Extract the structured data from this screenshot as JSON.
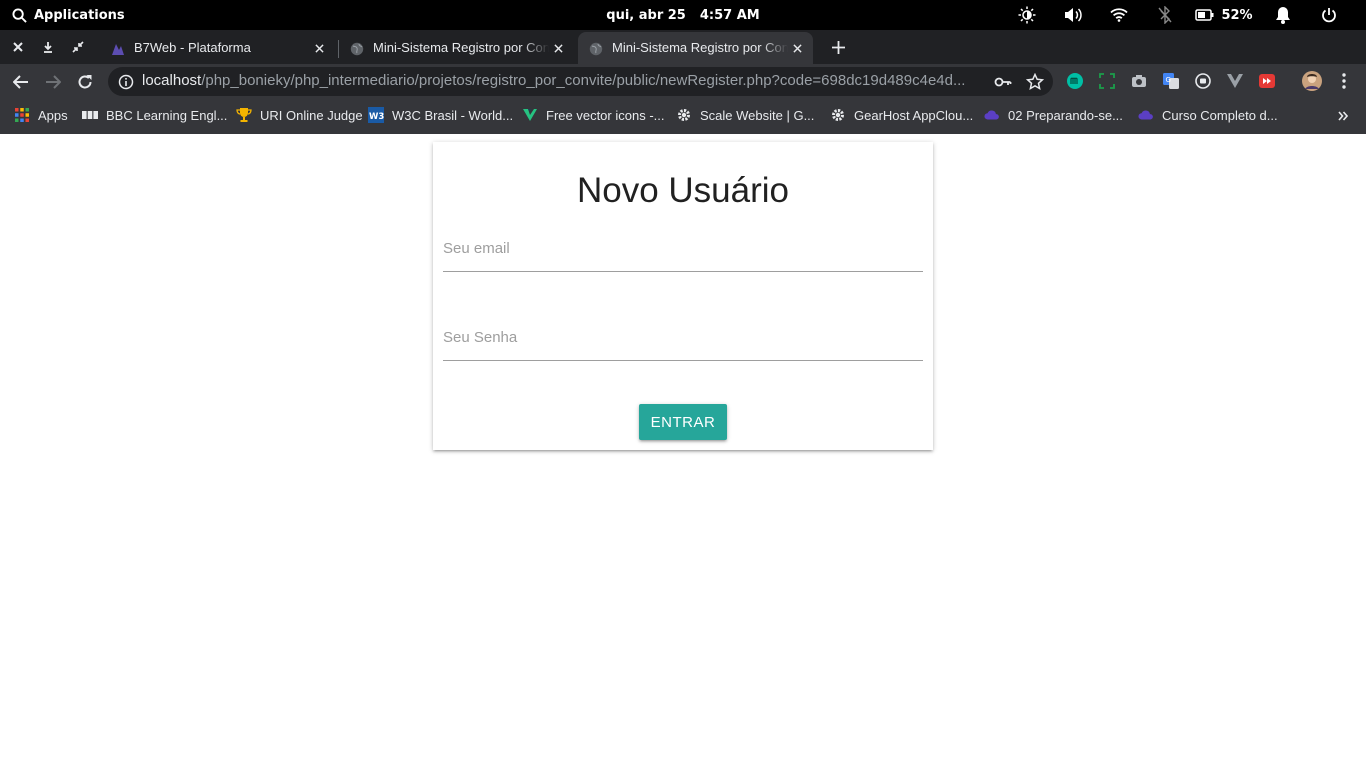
{
  "os": {
    "applications_label": "Applications",
    "date": "qui, abr 25",
    "time": "4:57 AM",
    "battery_percent": "52%"
  },
  "tabs": [
    {
      "title": "B7Web - Plataforma",
      "active": false
    },
    {
      "title": "Mini-Sistema Registro por Convite",
      "active": false
    },
    {
      "title": "Mini-Sistema Registro por Convite",
      "active": true
    }
  ],
  "omnibox": {
    "host": "localhost",
    "path": "/php_bonieky/php_intermediario/projetos/registro_por_convite/public/newRegister.php?code=698dc19d489c4e4d..."
  },
  "bookmarks": [
    {
      "label": "Apps",
      "icon": "apps-grid-icon"
    },
    {
      "label": "BBC Learning Engl...",
      "icon": "bbc-icon"
    },
    {
      "label": "URI Online Judge",
      "icon": "trophy-icon"
    },
    {
      "label": "W3C Brasil - World...",
      "icon": "w3c-icon"
    },
    {
      "label": "Free vector icons -...",
      "icon": "vector-icon"
    },
    {
      "label": "Scale Website | G...",
      "icon": "gear-icon"
    },
    {
      "label": "GearHost AppClou...",
      "icon": "gear-icon"
    },
    {
      "label": "02 Preparando-se...",
      "icon": "cloud-icon"
    },
    {
      "label": "Curso Completo d...",
      "icon": "cloud-icon"
    }
  ],
  "form": {
    "title": "Novo Usuário",
    "email_placeholder": "Seu email",
    "password_placeholder": "Seu Senha",
    "submit_label": "ENTRAR"
  },
  "colors": {
    "os_bar": "#000000",
    "tabstrip": "#202124",
    "toolbar": "#35363a",
    "button": "#26a69a"
  }
}
